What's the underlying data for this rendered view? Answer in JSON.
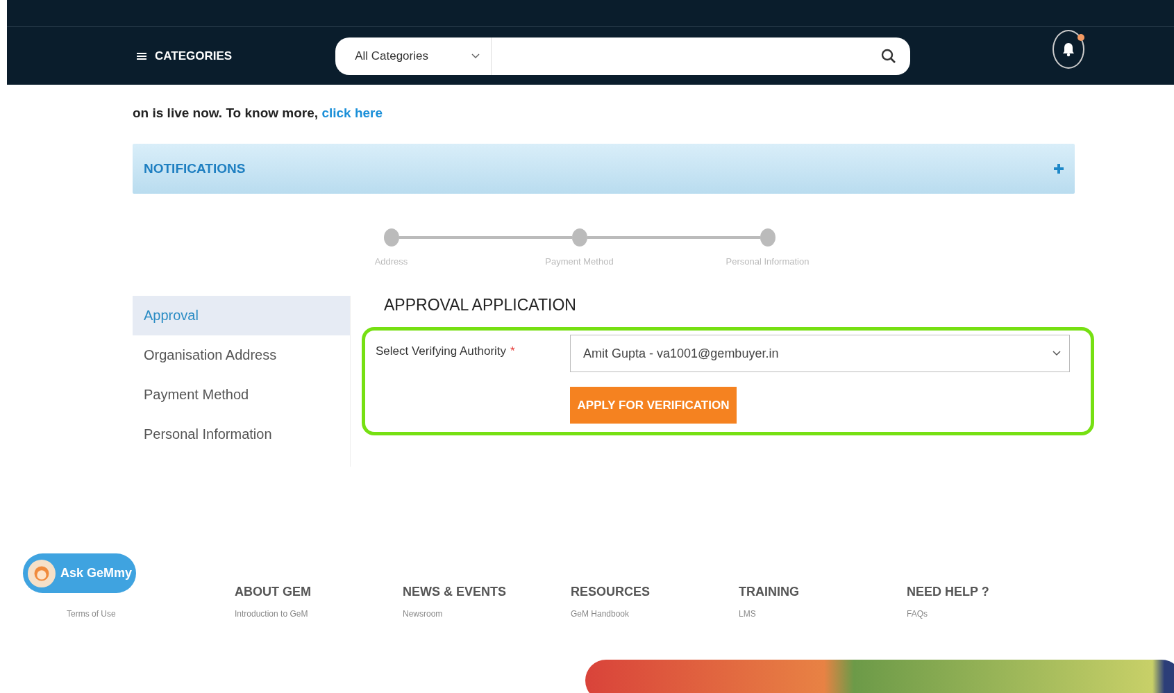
{
  "header": {
    "menu_label": "CATEGORIES",
    "search": {
      "category": "All Categories"
    },
    "notification_dot": true
  },
  "announcement": {
    "text": "on is live now. To know more,",
    "link": "click here"
  },
  "notifications_panel": {
    "title": "NOTIFICATIONS",
    "expanded": false
  },
  "steps": [
    {
      "label": "Address",
      "done": false
    },
    {
      "label": "Payment Method",
      "done": false
    },
    {
      "label": "Personal Information",
      "done": false
    }
  ],
  "sidebar": {
    "items": [
      {
        "label": "Approval",
        "selected": true
      },
      {
        "label": "Organisation Address",
        "selected": false
      },
      {
        "label": "Payment Method",
        "selected": false
      },
      {
        "label": "Personal Information",
        "selected": false
      }
    ]
  },
  "form": {
    "title": "APPROVAL APPLICATION",
    "field_label": "Select Verifying Authority",
    "required": true,
    "required_mark": "*",
    "value": "Amit Gupta - va1001@gembuyer.in",
    "button": "APPLY FOR VERIFICATION"
  },
  "chat_button": {
    "label": "Ask GeMmy"
  },
  "footer": {
    "columns": [
      {
        "heading": "ABOUT GEM",
        "link": "Introduction to GeM"
      },
      {
        "heading": "NEWS & EVENTS",
        "link": "Newsroom"
      },
      {
        "heading": "RESOURCES",
        "link": "GeM Handbook"
      },
      {
        "heading": "TRAINING",
        "link": "LMS"
      },
      {
        "heading": "NEED HELP ?",
        "link": "FAQs"
      }
    ],
    "first_link": "Terms of Use"
  }
}
